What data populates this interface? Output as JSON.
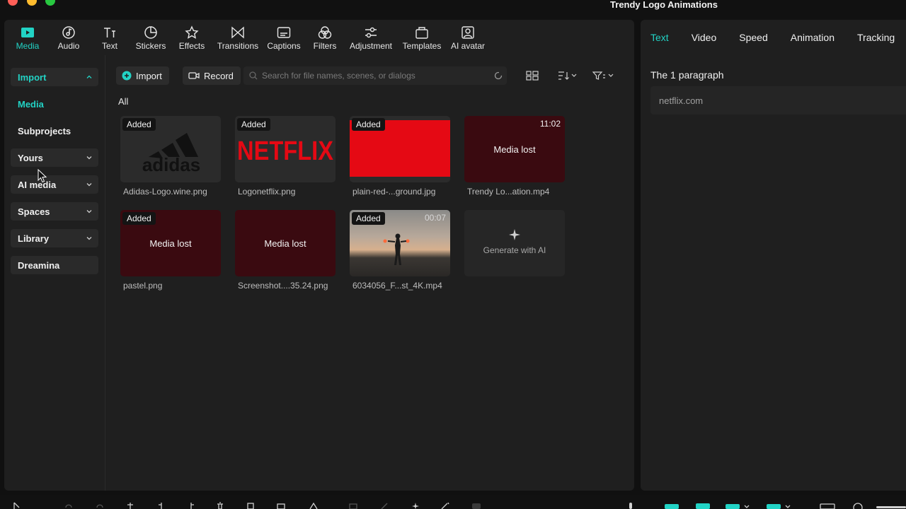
{
  "window": {
    "title": "Trendy Logo Animations"
  },
  "toolbar": {
    "items": [
      {
        "label": "Media",
        "icon": "media-icon",
        "active": true
      },
      {
        "label": "Audio",
        "icon": "audio-icon"
      },
      {
        "label": "Text",
        "icon": "text-icon"
      },
      {
        "label": "Stickers",
        "icon": "stickers-icon"
      },
      {
        "label": "Effects",
        "icon": "effects-icon"
      },
      {
        "label": "Transitions",
        "icon": "transitions-icon"
      },
      {
        "label": "Captions",
        "icon": "captions-icon"
      },
      {
        "label": "Filters",
        "icon": "filters-icon"
      },
      {
        "label": "Adjustment",
        "icon": "adjustment-icon"
      },
      {
        "label": "Templates",
        "icon": "templates-icon"
      },
      {
        "label": "AI avatar",
        "icon": "ai-avatar-icon"
      }
    ]
  },
  "sidebar": {
    "items": [
      {
        "label": "Import"
      },
      {
        "label": "Media"
      },
      {
        "label": "Subprojects"
      },
      {
        "label": "Yours"
      },
      {
        "label": "AI media"
      },
      {
        "label": "Spaces"
      },
      {
        "label": "Library"
      },
      {
        "label": "Dreamina"
      }
    ]
  },
  "content": {
    "import_label": "Import",
    "record_label": "Record",
    "search_placeholder": "Search for file names, scenes, or dialogs",
    "all_label": "All",
    "media": [
      {
        "name": "Adidas-Logo.wine.png",
        "badge": "Added",
        "logo_text": "adidas"
      },
      {
        "name": "Logonetflix.png",
        "badge": "Added",
        "logo_text": "NETFLIX"
      },
      {
        "name": "plain-red-...ground.jpg",
        "badge": "Added"
      },
      {
        "name": "Trendy Lo...ation.mp4",
        "duration": "11:02",
        "status": "Media lost"
      },
      {
        "name": "pastel.png",
        "badge": "Added",
        "status": "Media lost"
      },
      {
        "name": "Screenshot....35.24.png",
        "status": "Media lost"
      },
      {
        "name": "6034056_F...st_4K.mp4",
        "badge": "Added",
        "duration": "00:07"
      },
      {
        "label": "Generate with AI"
      }
    ]
  },
  "right_panel": {
    "tabs": [
      {
        "label": "Text",
        "active": true
      },
      {
        "label": "Video"
      },
      {
        "label": "Speed"
      },
      {
        "label": "Animation"
      },
      {
        "label": "Tracking"
      }
    ],
    "paragraph_title": "The 1 paragraph",
    "text_value": "netflix.com"
  },
  "colors": {
    "accent": "#22d3c5",
    "lost_bg": "#3a0a10",
    "red": "#e50914"
  }
}
